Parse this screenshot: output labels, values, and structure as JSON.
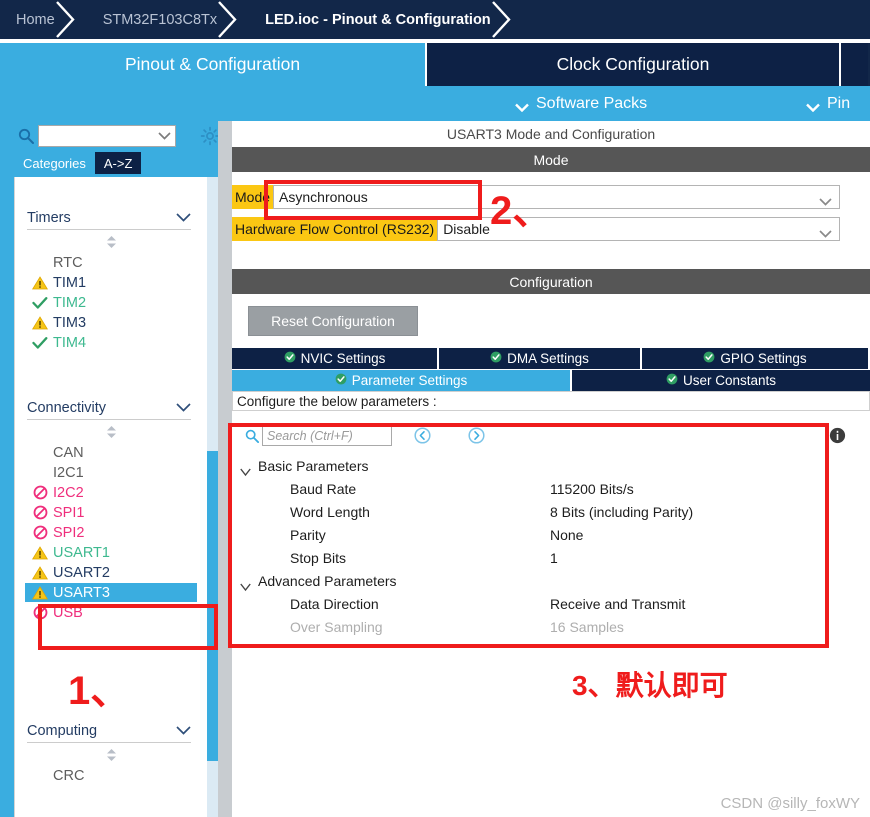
{
  "breadcrumb": {
    "items": [
      {
        "label": "Home",
        "active": false
      },
      {
        "label": "STM32F103C8Tx",
        "active": false
      },
      {
        "label": "LED.ioc - Pinout & Configuration",
        "active": true
      }
    ]
  },
  "main_tabs": [
    {
      "label": "Pinout & Configuration",
      "selected": true
    },
    {
      "label": "Clock Configuration",
      "selected": false
    },
    {
      "label": "",
      "selected": false
    }
  ],
  "sub_bar": {
    "software_packs": "Software Packs",
    "pinout": "Pin"
  },
  "sidebar": {
    "search_value": "",
    "search_placeholder": "",
    "gear_icon": "gear-icon",
    "category_tabs": [
      {
        "label": "Categories",
        "selected": true
      },
      {
        "label": "A->Z",
        "selected": false
      }
    ],
    "groups": [
      {
        "name": "Timers",
        "items": [
          {
            "label": "RTC",
            "status": "plain"
          },
          {
            "label": "TIM1",
            "status": "warn"
          },
          {
            "label": "TIM2",
            "status": "ok"
          },
          {
            "label": "TIM3",
            "status": "warn"
          },
          {
            "label": "TIM4",
            "status": "ok"
          }
        ]
      },
      {
        "name": "Connectivity",
        "items": [
          {
            "label": "CAN",
            "status": "plain"
          },
          {
            "label": "I2C1",
            "status": "plain"
          },
          {
            "label": "I2C2",
            "status": "ban"
          },
          {
            "label": "SPI1",
            "status": "ban"
          },
          {
            "label": "SPI2",
            "status": "ban"
          },
          {
            "label": "USART1",
            "status": "warn-green"
          },
          {
            "label": "USART2",
            "status": "warn"
          },
          {
            "label": "USART3",
            "status": "warn",
            "selected": true
          },
          {
            "label": "USB",
            "status": "ban"
          }
        ]
      },
      {
        "name": "Computing",
        "items": [
          {
            "label": "CRC",
            "status": "plain"
          }
        ]
      }
    ]
  },
  "right_panel": {
    "header": "USART3 Mode and Configuration",
    "mode_section_title": "Mode",
    "mode_fields": [
      {
        "label": "Mode",
        "value": "Asynchronous"
      },
      {
        "label": "Hardware Flow Control (RS232)",
        "value": "Disable"
      }
    ],
    "configuration_section_title": "Configuration",
    "reset_button": "Reset Configuration",
    "config_tabs_row1": [
      {
        "label": "NVIC Settings",
        "selected": false
      },
      {
        "label": "DMA Settings",
        "selected": false
      },
      {
        "label": "GPIO Settings",
        "selected": false
      }
    ],
    "config_tabs_row2": [
      {
        "label": "Parameter Settings",
        "selected": true
      },
      {
        "label": "User Constants",
        "selected": false
      }
    ],
    "configure_note": "Configure the below parameters :",
    "param_search_placeholder": "Search (Ctrl+F)",
    "param_search_value": "",
    "nav_prev_icon": "chevron-left-circle-icon",
    "nav_next_icon": "chevron-right-circle-icon",
    "info_icon": "info-icon",
    "parameters": [
      {
        "type": "group",
        "key": "Basic Parameters"
      },
      {
        "type": "item",
        "key": "Baud Rate",
        "value": "115200 Bits/s",
        "disabled": false
      },
      {
        "type": "item",
        "key": "Word Length",
        "value": "8 Bits (including Parity)",
        "disabled": false
      },
      {
        "type": "item",
        "key": "Parity",
        "value": "None",
        "disabled": false
      },
      {
        "type": "item",
        "key": "Stop Bits",
        "value": "1",
        "disabled": false
      },
      {
        "type": "group",
        "key": "Advanced Parameters"
      },
      {
        "type": "item",
        "key": "Data Direction",
        "value": "Receive and Transmit",
        "disabled": false
      },
      {
        "type": "item",
        "key": "Over Sampling",
        "value": "16 Samples",
        "disabled": true
      }
    ]
  },
  "annotations": [
    {
      "id": "step1",
      "text": "1、"
    },
    {
      "id": "step2",
      "text": "2、"
    },
    {
      "id": "step3",
      "text": "3、默认即可"
    }
  ],
  "watermark": "CSDN @silly_foxWY",
  "colors": {
    "accent_blue": "#3aade0",
    "dark_navy": "#122749",
    "annotation_red": "#ef1c1c",
    "highlight_yellow": "#fbc713",
    "warn_yellow": "#f5c518",
    "ok_green": "#3db98f",
    "ban_pink": "#ef2e7c",
    "grey_bar": "#565656"
  }
}
